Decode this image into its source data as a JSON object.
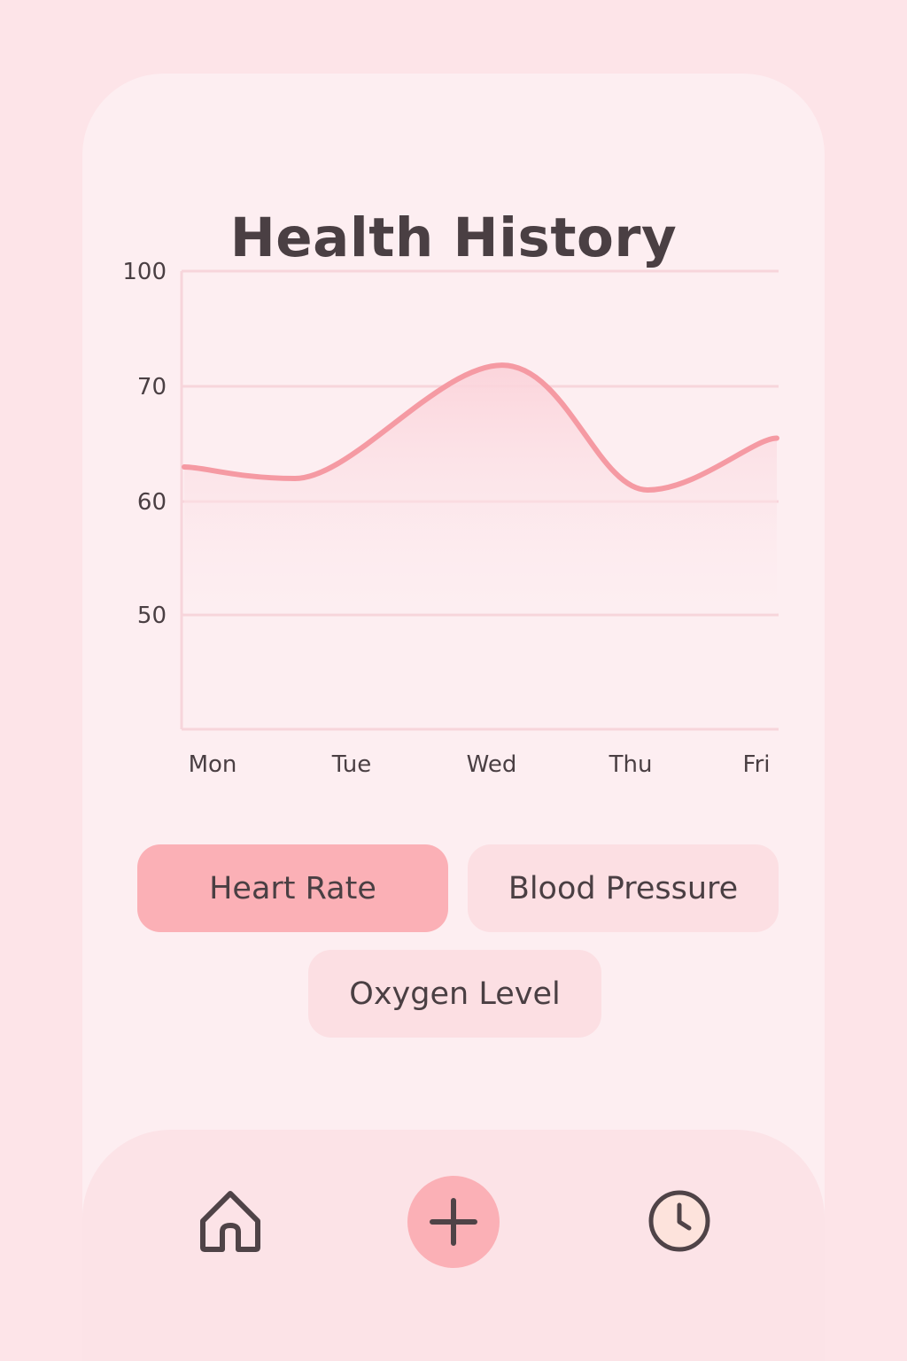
{
  "header": {
    "title": "Health History"
  },
  "chart_data": {
    "type": "line",
    "x": [
      "Mon",
      "Tue",
      "Wed",
      "Thu",
      "Fri"
    ],
    "series": [
      {
        "values": [
          63,
          62,
          75.5,
          61,
          65.5
        ]
      }
    ],
    "y_ticks": [
      "100",
      "70",
      "60",
      "50"
    ],
    "grid": true,
    "colors": {
      "line": "#f59aa3",
      "area": "#fbd3da",
      "grid": "#f7d5db"
    }
  },
  "metric_tabs": [
    {
      "label": "Heart Rate",
      "active": true
    },
    {
      "label": "Blood Pressure",
      "active": false
    },
    {
      "label": "Oxygen Level",
      "active": false
    }
  ],
  "bottom_nav": {
    "items": [
      {
        "icon": "home-icon"
      },
      {
        "icon": "plus-icon"
      },
      {
        "icon": "clock-icon"
      }
    ]
  },
  "colors": {
    "background": "#fde4e8",
    "card": "#fdeef1",
    "accent": "#fbb0b6",
    "text": "#4a3f43"
  }
}
